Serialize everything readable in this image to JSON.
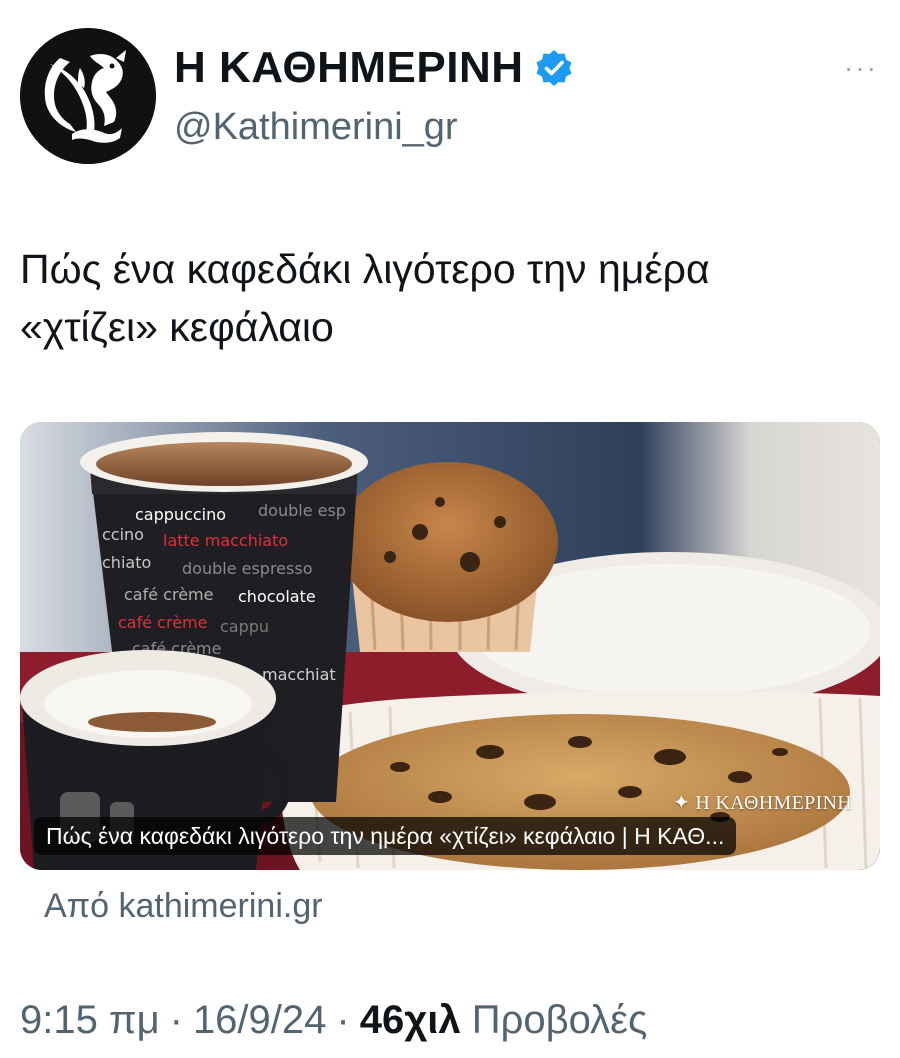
{
  "author": {
    "display_name": "Η ΚΑΘΗΜΕΡΙΝΗ",
    "handle": "@Kathimerini_gr",
    "avatar_icon": "griffin-logo-icon",
    "verified_icon": "verified-badge-icon",
    "verified_color": "#1d9bf0"
  },
  "more_label": "···",
  "tweet": {
    "text_line1": "Πώς ένα καφεδάκι λιγότερο την ημέρα",
    "text_line2": "«χτίζει» κεφάλαιο"
  },
  "card": {
    "watermark": "Η ΚΑΘΗΜΕΡΙΝΗ",
    "caption": "Πώς ένα καφεδάκι λιγότερο την ημέρα «χτίζει» κεφάλαιο | Η ΚΑΘ...",
    "cup_words": {
      "w1": "cappuccino",
      "w2": "double esp",
      "w3": "ccino",
      "w4": "latte macchiato",
      "w5": "chiato",
      "w6": "double espresso",
      "w7": "café crème",
      "w8": "chocolate",
      "w9": "café crème",
      "w10": "cappu",
      "w11": "café crème",
      "w12": "macchiat"
    }
  },
  "source": "Από kathimerini.gr",
  "meta": {
    "time": "9:15 πμ",
    "date": "16/9/24",
    "views_count": "46χιλ",
    "views_label": "Προβολές",
    "separator": "·"
  }
}
